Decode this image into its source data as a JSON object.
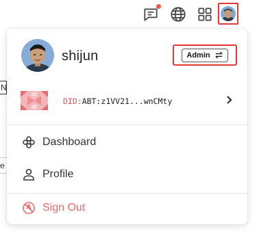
{
  "topbar": {
    "icons": [
      "chat-icon",
      "globe-icon",
      "apps-grid-icon",
      "avatar"
    ],
    "notification_color": "#e85a4f"
  },
  "background": {
    "fragment_1": "N",
    "fragment_2": "e"
  },
  "user": {
    "name": "shijun",
    "role_label": "Admin"
  },
  "did": {
    "prefix": "DID:",
    "value": "ABT:z1VV21...wnCMty"
  },
  "menu": {
    "items": [
      {
        "label": "Dashboard",
        "icon": "dashboard-icon"
      },
      {
        "label": "Profile",
        "icon": "person-icon"
      }
    ],
    "sign_out": {
      "label": "Sign Out",
      "icon": "sign-out-icon",
      "color": "#ec6b6b"
    }
  },
  "colors": {
    "highlight": "#e53935"
  }
}
